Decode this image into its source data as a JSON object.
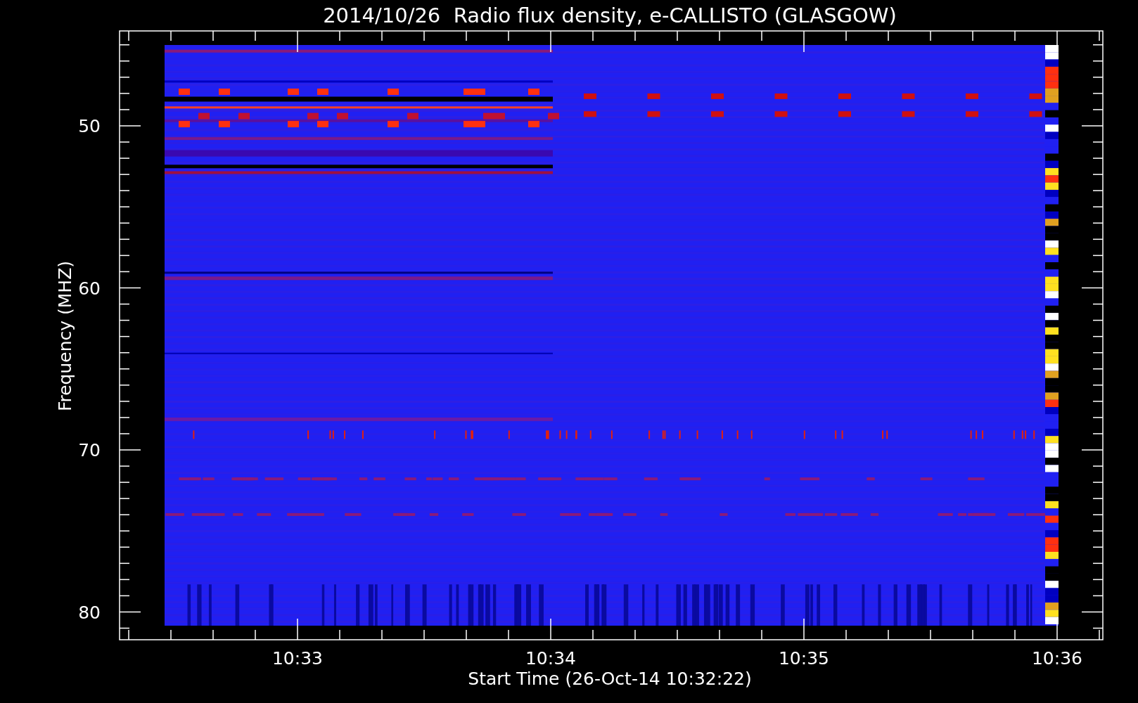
{
  "title": "2014/10/26  Radio flux density, e-CALLISTO (GLASGOW)",
  "y_axis": {
    "label": "Frequency (MHZ)",
    "ticks": [
      "50",
      "60",
      "70",
      "80"
    ]
  },
  "x_axis": {
    "label": "Start Time (26-Oct-14 10:32:22)",
    "ticks": [
      "10:33",
      "10:34",
      "10:35",
      "10:36"
    ]
  }
}
